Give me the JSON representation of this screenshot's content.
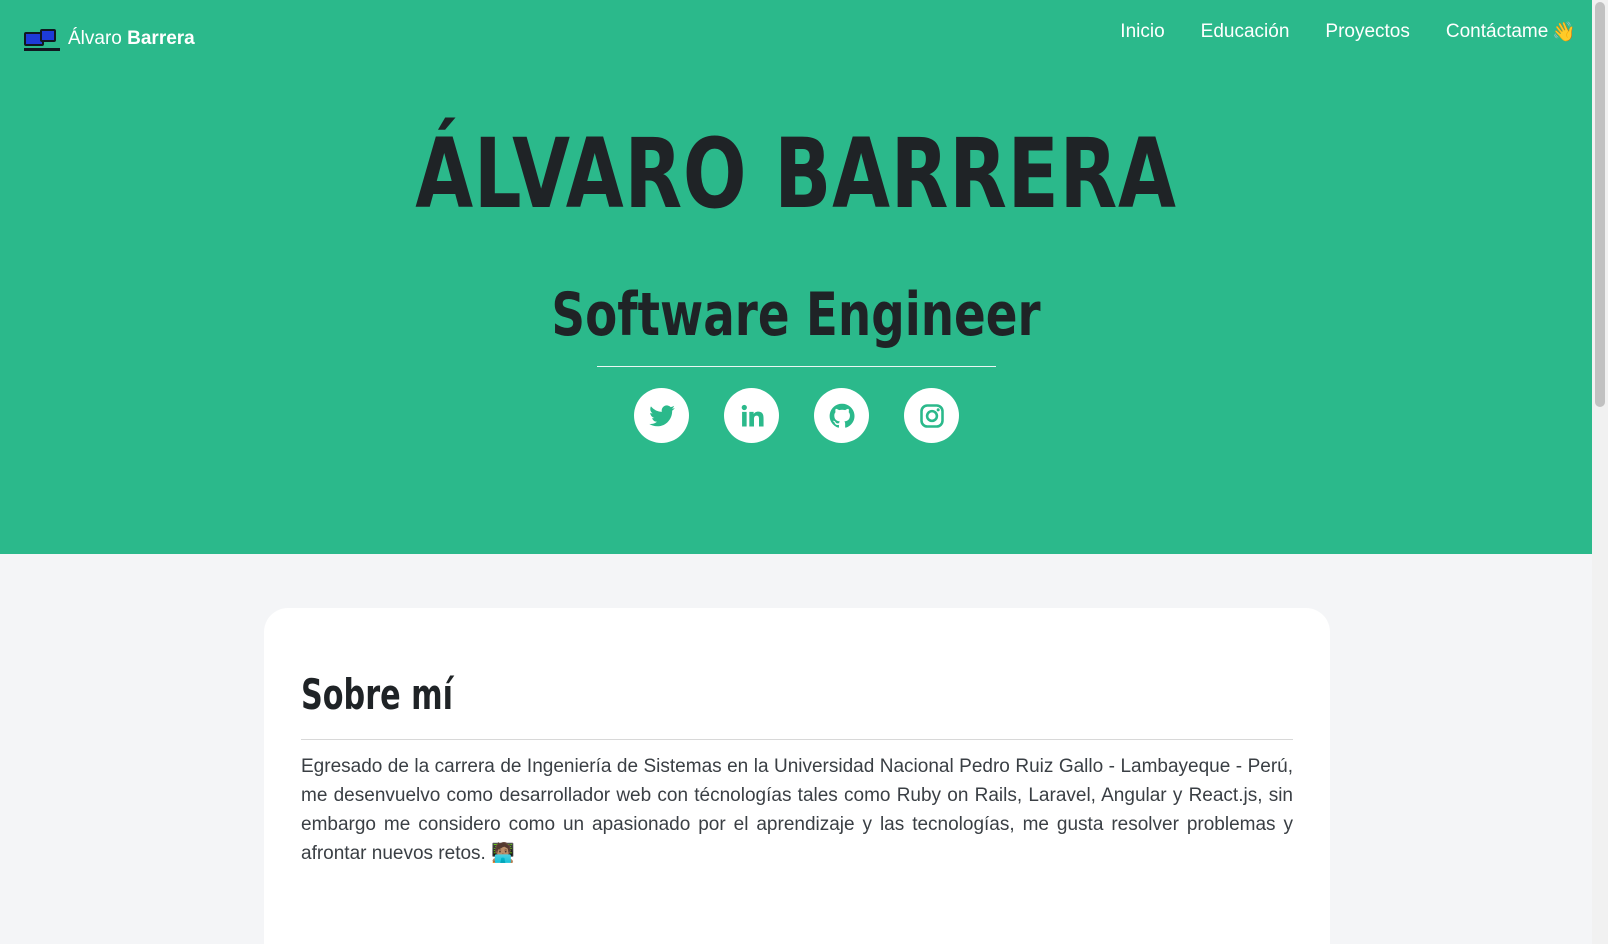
{
  "navbar": {
    "brand_light": "Álvaro",
    "brand_bold": "Barrera",
    "links": [
      {
        "label": "Inicio"
      },
      {
        "label": "Educación"
      },
      {
        "label": "Proyectos"
      },
      {
        "label": "Contáctame",
        "emoji": "👋"
      }
    ]
  },
  "hero": {
    "title": "ÁLVARO BARRERA",
    "subtitle": "Software Engineer",
    "socials": [
      {
        "name": "twitter-icon"
      },
      {
        "name": "linkedin-icon"
      },
      {
        "name": "github-icon"
      },
      {
        "name": "instagram-icon"
      }
    ]
  },
  "about": {
    "title": "Sobre mí",
    "text": "Egresado de la carrera de Ingeniería de Sistemas en la Universidad Nacional Pedro Ruiz Gallo - Lambayeque - Perú, me desenvuelvo como desarrollador web con técnologías tales como Ruby on Rails, Laravel, Angular y React.js, sin embargo me considero como un apasionado por el aprendizaje y las tecnologías, me gusta resolver problemas y afrontar nuevos retos. 🧑🏽‍💻"
  },
  "colors": {
    "hero_bg": "#2bb98b",
    "page_bg": "#f4f5f7",
    "heading": "#1f2326"
  }
}
